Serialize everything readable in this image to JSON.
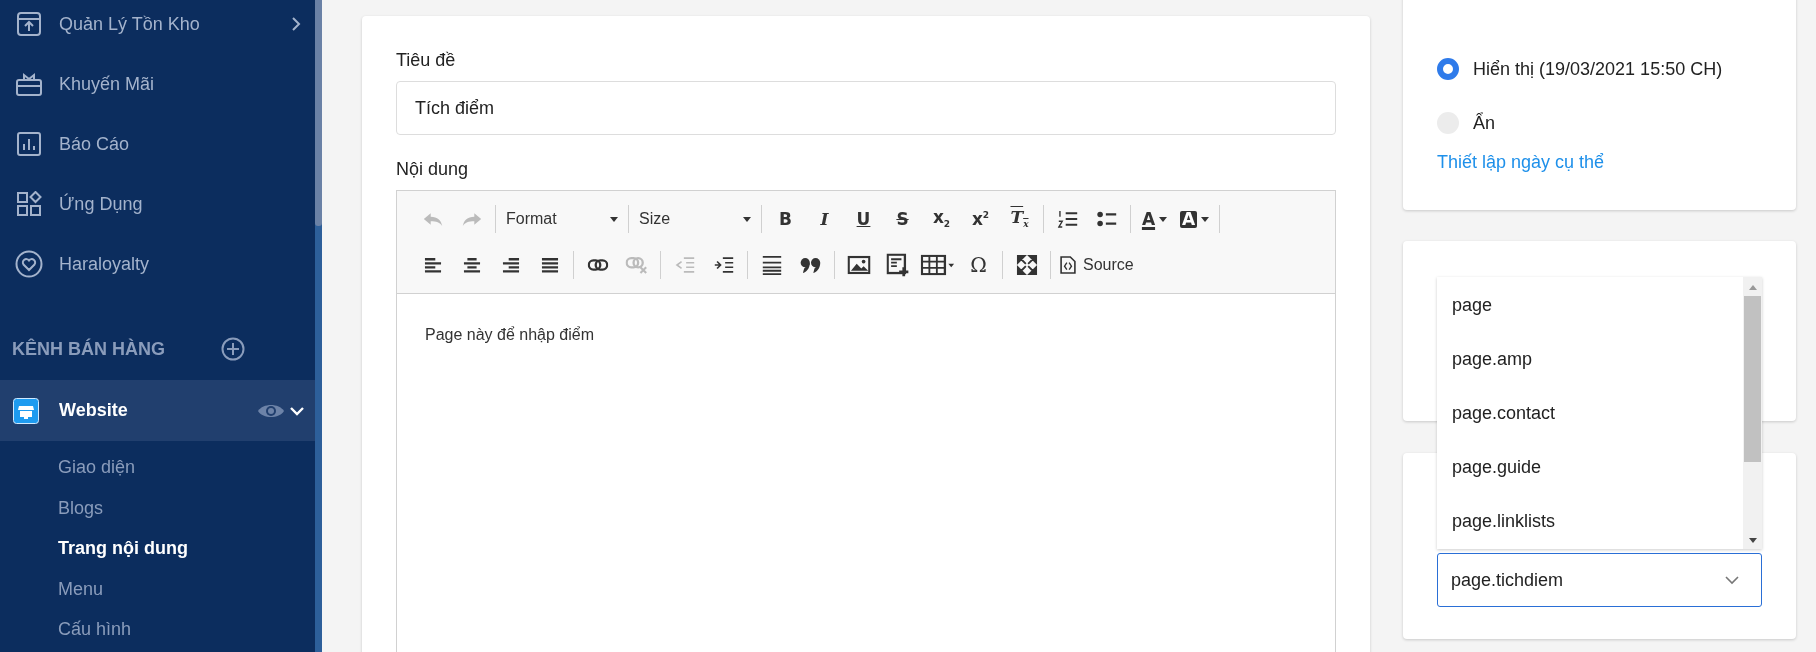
{
  "sidebar": {
    "items": [
      {
        "label": "Quản Lý Tồn Kho",
        "kind": "inventory",
        "expandable": true
      },
      {
        "label": "Khuyến Mãi",
        "kind": "gift",
        "expandable": false
      },
      {
        "label": "Báo Cáo",
        "kind": "report",
        "expandable": false
      },
      {
        "label": "Ứng Dụng",
        "kind": "apps",
        "expandable": false
      },
      {
        "label": "Haraloyalty",
        "kind": "heart",
        "expandable": false
      }
    ],
    "section": {
      "title": "KÊNH BÁN HÀNG"
    },
    "channel": {
      "label": "Website",
      "expanded": true,
      "children": [
        {
          "label": "Giao diện",
          "selected": false
        },
        {
          "label": "Blogs",
          "selected": false
        },
        {
          "label": "Trang nội dung",
          "selected": true
        },
        {
          "label": "Menu",
          "selected": false
        },
        {
          "label": "Cấu hình",
          "selected": false
        }
      ]
    }
  },
  "form": {
    "title_label": "Tiêu đề",
    "title_value": "Tích điểm",
    "content_label": "Nội dung",
    "toolbar": [
      [
        [
          {
            "kind": "undo",
            "disabled": true
          },
          {
            "kind": "redo",
            "disabled": true
          }
        ],
        [
          {
            "kind": "dropdown",
            "label": "Format",
            "disabled": false
          }
        ],
        [
          {
            "kind": "dropdown",
            "label": "Size",
            "disabled": false
          }
        ],
        [
          {
            "kind": "bold",
            "label": "B",
            "disabled": false
          },
          {
            "kind": "italic",
            "label": "I",
            "disabled": false
          },
          {
            "kind": "underline",
            "label": "U",
            "disabled": false
          },
          {
            "kind": "strike",
            "label": "S",
            "disabled": false
          },
          {
            "kind": "subscript",
            "label": "x$_{2}$",
            "disabled": false
          },
          {
            "kind": "superscript",
            "label": "x$^{2}$",
            "disabled": false
          },
          {
            "kind": "clear",
            "label": "T$_{x}$",
            "disabled": false
          }
        ],
        [
          {
            "kind": "numbered",
            "disabled": false
          },
          {
            "kind": "bulleted",
            "disabled": false
          }
        ],
        [
          {
            "kind": "color",
            "label": "A",
            "disabled": false
          },
          {
            "kind": "background",
            "label": "A",
            "disabled": false
          }
        ]
      ],
      [
        [
          {
            "kind": "left",
            "disabled": false
          },
          {
            "kind": "center",
            "disabled": false
          },
          {
            "kind": "right",
            "disabled": false
          },
          {
            "kind": "justify",
            "disabled": false
          }
        ],
        [
          {
            "kind": "link",
            "disabled": false
          },
          {
            "kind": "unlink",
            "disabled": true
          }
        ],
        [
          {
            "kind": "outdent",
            "disabled": true
          },
          {
            "kind": "indent",
            "disabled": false
          }
        ],
        [
          {
            "kind": "rule",
            "disabled": false
          },
          {
            "kind": "quote",
            "disabled": false
          }
        ],
        [
          {
            "kind": "image",
            "disabled": false
          },
          {
            "kind": "template",
            "disabled": false
          },
          {
            "kind": "table",
            "disabled": false
          },
          {
            "kind": "special",
            "label": "Ω",
            "disabled": false
          }
        ],
        [
          {
            "kind": "maximize",
            "disabled": false
          }
        ],
        [
          {
            "kind": "source",
            "label": "Source",
            "disabled": false
          }
        ]
      ]
    ],
    "body": "Page này để nhập điểm"
  },
  "visibility": {
    "options": [
      {
        "label": "Hiển thị (19/03/2021 15:50 CH)",
        "selected": true
      },
      {
        "label": "Ẩn",
        "selected": false
      }
    ],
    "link": "Thiết lập ngày cụ thể"
  },
  "template": {
    "value": "page.tichdiem",
    "expanded": true,
    "options": [
      "page",
      "page.amp",
      "page.contact",
      "page.guide",
      "page.linklists"
    ]
  }
}
